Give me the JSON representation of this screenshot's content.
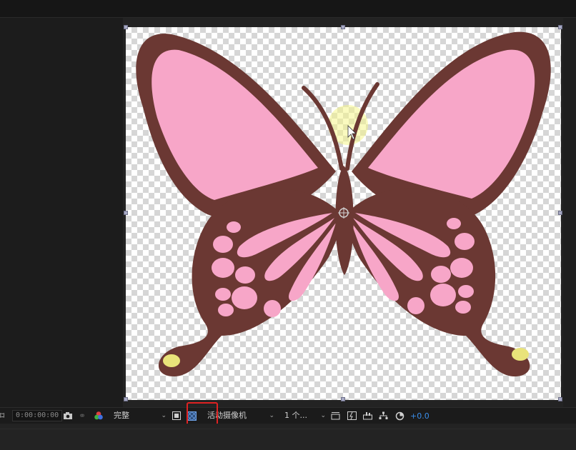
{
  "toolbar": {
    "timecode": "0:00:00:00",
    "resolution": "完整",
    "camera": "活动摄像机",
    "views": "1 个...",
    "exposure": "+0.0"
  },
  "icons": {
    "region": "region-of-interest-icon",
    "snapshot": "camera-icon",
    "show_snapshot": "show-snapshot-icon",
    "channels": "color-channels-icon",
    "mask": "mask-visibility-icon",
    "transparency_grid": "transparency-grid-icon",
    "layout": "view-layout-icon",
    "fast_preview": "fast-preview-icon",
    "timeline": "timeline-icon",
    "flowchart": "flowchart-icon",
    "reset_exposure": "reset-exposure-icon"
  },
  "colors": {
    "wing_outline": "#6b3833",
    "wing_fill": "#f7a6c8",
    "spot_fill": "#e9e37a",
    "highlight_box": "#e02222",
    "exposure_value": "#3a8eea"
  }
}
